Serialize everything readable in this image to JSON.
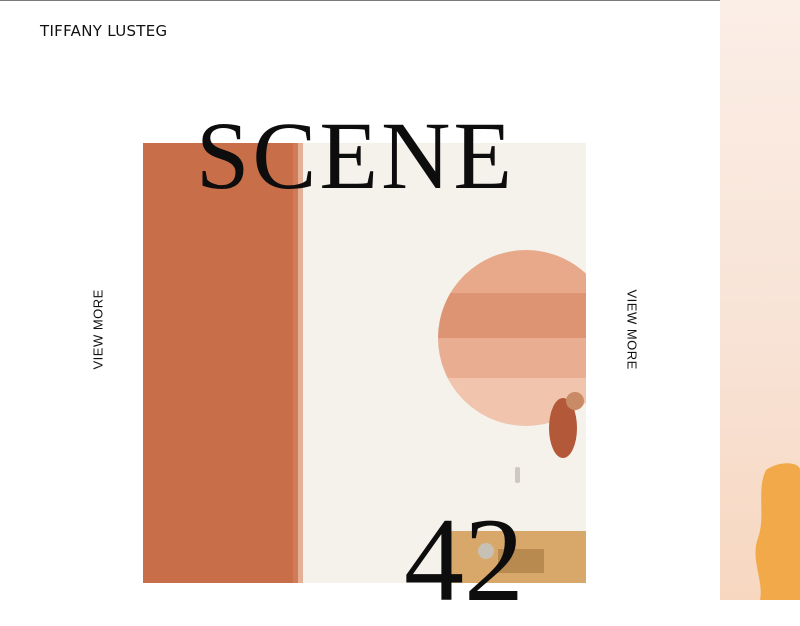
{
  "brand": {
    "name": "TIFFANY LUSTEG"
  },
  "hero": {
    "title": "SCENE",
    "number": "42"
  },
  "nav": {
    "view_more_left": "VIEW MORE",
    "view_more_right": "VIEW MORE"
  },
  "colors": {
    "terracotta": "#c86f49",
    "wall": "#f5f1eb",
    "accent_orange": "#f2a94a"
  }
}
